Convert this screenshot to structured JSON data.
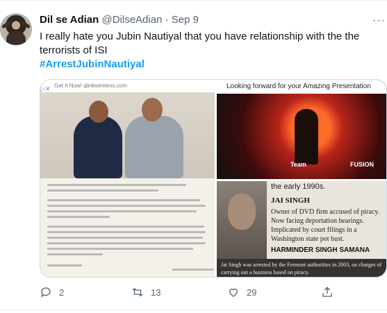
{
  "tweet": {
    "name": "Dil se Adian",
    "handle": "@DilseAdian",
    "separator": "·",
    "date": "Sep 9",
    "text": "I really hate you Jubin Nautiyal that you have relationship with the the terrorists of ISI",
    "hashtag": "#ArrestJubinNautiyal"
  },
  "media": {
    "ad_text": "Get It Now! qlinkwireless.com",
    "concert_caption": "Looking forward for your Amazing Presentation",
    "concert_labels": [
      "Team",
      "FUSION"
    ],
    "clipping": {
      "t1": "the early 1990s.",
      "t2": "JAI SINGH",
      "t3": "Owner of DVD firm accused of piracy. Now facing deportation hearings. Implicated by court filings in a Washington state pot bust.",
      "t4": "HARMINDER SINGH SAMANA",
      "caption": "Jai Singh was arrested by the Fermont authorities in 2003, on charges of carrying out a business based on piracy."
    }
  },
  "actions": {
    "reply_count": "2",
    "retweet_count": "13",
    "like_count": "29"
  }
}
